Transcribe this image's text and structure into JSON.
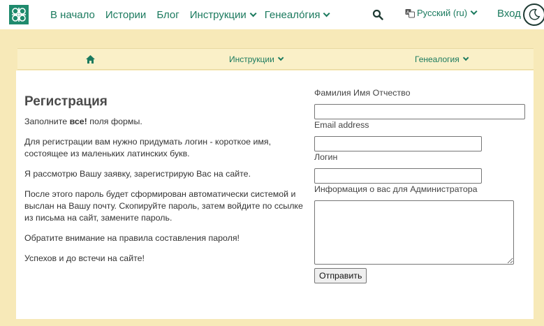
{
  "header": {
    "nav": [
      {
        "label": "В начало",
        "dropdown": false
      },
      {
        "label": "Истории",
        "dropdown": false
      },
      {
        "label": "Блог",
        "dropdown": false
      },
      {
        "label": "Инструкции",
        "dropdown": true
      },
      {
        "label": "Генеало́гия",
        "dropdown": true
      }
    ],
    "language_label": "Русский (ru)",
    "login_label": "Вход"
  },
  "subnav": {
    "items": [
      {
        "label": "Инструкции"
      },
      {
        "label": "Генеалогия"
      }
    ]
  },
  "registration": {
    "title": "Регистрация",
    "intro_prefix": "Заполните ",
    "intro_bold": "все!",
    "intro_suffix": " поля формы.",
    "paragraphs": [
      "Для регистрации вам нужно придумать логин - короткое имя, состоящее из маленьких латинских букв.",
      "Я рассмотрю Вашу заявку, зарегистрирую Вас на сайте.",
      "После этого пароль будет сформирован автоматически системой и выслан на Вашу почту. Скопируйте пароль, затем войдите по ссылке из письма на сайт, замените пароль.",
      "Обратите внимание на правила составления пароля!",
      "Успехов и до встечи на сайте!"
    ]
  },
  "form": {
    "fullname_label": "Фамилия Имя Отчество",
    "fullname_value": "",
    "email_label": "Email address",
    "email_value": "",
    "login_label": "Логин",
    "login_value": "",
    "info_label": "Информация о вас для Администратора",
    "info_value": "",
    "submit_label": "Отправить"
  },
  "colors": {
    "accent": "#1b7a5e",
    "page_background": "#f7e9b8",
    "logo_background": "#1f8a6d"
  },
  "icons": [
    "site-logo-icon",
    "search-icon",
    "translate-icon",
    "moon-icon",
    "home-icon",
    "chevron-down-icon"
  ]
}
